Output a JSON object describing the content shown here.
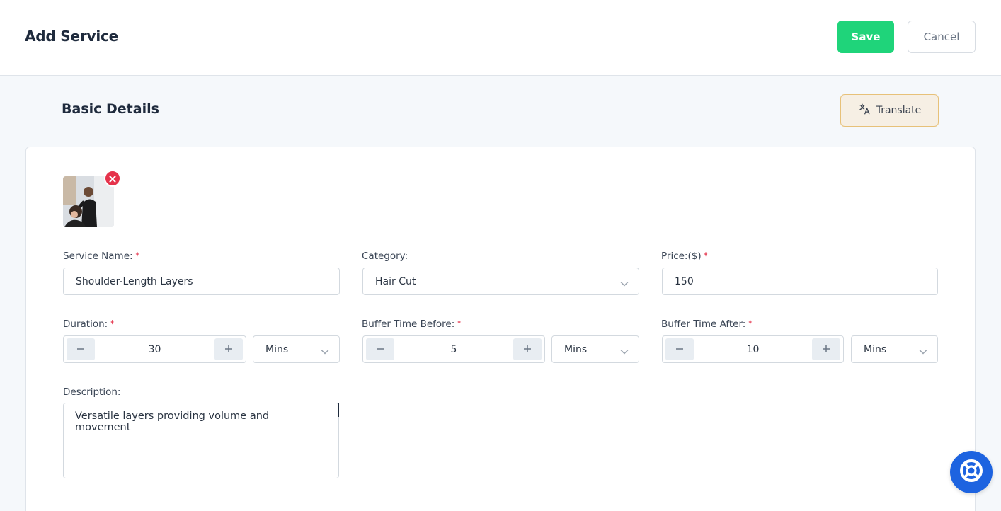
{
  "header": {
    "title": "Add Service",
    "save_label": "Save",
    "cancel_label": "Cancel"
  },
  "section": {
    "title": "Basic Details",
    "translate_label": "Translate"
  },
  "form": {
    "service_name": {
      "label": "Service Name:",
      "required": "*",
      "value": "Shoulder-Length Layers"
    },
    "category": {
      "label": "Category:",
      "value": "Hair Cut"
    },
    "price": {
      "label": "Price:($)",
      "required": "*",
      "value": "150"
    },
    "duration": {
      "label": "Duration:",
      "required": "*",
      "value": "30",
      "unit": "Mins"
    },
    "buffer_before": {
      "label": "Buffer Time Before:",
      "required": "*",
      "value": "5",
      "unit": "Mins"
    },
    "buffer_after": {
      "label": "Buffer Time After:",
      "required": "*",
      "value": "10",
      "unit": "Mins"
    },
    "description": {
      "label": "Description:",
      "value": "Versatile layers providing volume and movement"
    }
  },
  "icons": {
    "translate": "translate-icon",
    "remove": "close-icon",
    "chevron": "chevron-down-icon",
    "minus": "minus-icon",
    "plus": "plus-icon",
    "help": "lifebuoy-icon"
  },
  "colors": {
    "primary": "#1fd47a",
    "danger": "#e5334b",
    "help": "#1d63e0",
    "translate_bg": "#f6efe4",
    "translate_border": "#e7c179"
  }
}
